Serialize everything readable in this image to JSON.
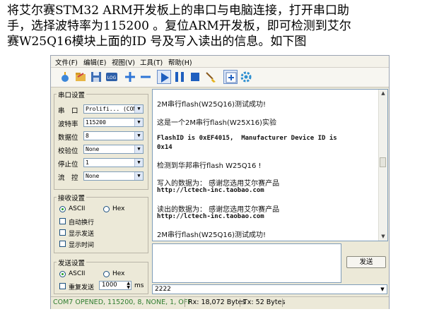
{
  "caption": {
    "line1": " 将艾尔赛STM32 ARM开发板上的串口与电脑连接，打开串口助",
    "line2": "手，选择波特率为115200 。复位ARM开发板，即可检测到艾尔",
    "line3": "赛W25Q16模块上面的ID 号及写入读出的信息。如下图"
  },
  "menu": [
    "文件(F)",
    "编辑(E)",
    "视图(V)",
    "工具(T)",
    "帮助(H)"
  ],
  "toolbar_icons": [
    "new-icon",
    "open-icon",
    "save-icon",
    "log-icon",
    "plus-icon",
    "minus-icon",
    "play-icon",
    "pause-icon",
    "stop-icon",
    "clear-brush-icon",
    "add-window-icon",
    "settings-icon"
  ],
  "serial_settings": {
    "title": "串口设置",
    "port_label": "串　口",
    "port_value": "Prolifi... (COM7",
    "baud_label": "波特率",
    "baud_value": "115200",
    "databits_label": "数据位",
    "databits_value": "8",
    "parity_label": "校验位",
    "parity_value": "None",
    "stopbits_label": "停止位",
    "stopbits_value": "1",
    "flow_label": "流　控",
    "flow_value": "None"
  },
  "receive_settings": {
    "title": "接收设置",
    "ascii": "ASCII",
    "hex": "Hex",
    "selected": "ASCII",
    "auto_wrap": "自动换行",
    "show_send": "显示发送",
    "show_time": "显示时间"
  },
  "send_settings": {
    "title": "发送设置",
    "ascii": "ASCII",
    "hex": "Hex",
    "selected": "ASCII",
    "repeat_label": "重复发送",
    "repeat_interval": "1000",
    "unit": "ms"
  },
  "receive_lines": [
    "2M串行flash(W25Q16)测试成功!",
    "这是一个2M串行flash(W25X16)实验",
    "FlashID is 0xEF4015,  Manufacturer Device ID is",
    "0x14",
    "检测到华邦串行flash W25Q16 !",
    "写入的数据为： 感谢您选用艾尔赛产品",
    "http://lctech-inc.taobao.com",
    "读出的数据为： 感谢您选用艾尔赛产品",
    "http://lctech-inc.taobao.com",
    "2M串行flash(W25Q16)测试成功!"
  ],
  "send": {
    "button": "发送",
    "history_value": "2222"
  },
  "status": {
    "port_state": "COM7 OPENED, 115200, 8, NONE, 1, OFF",
    "rx": "Rx: 18,072 Bytes",
    "tx": "Tx: 52 Bytes"
  },
  "colors": {
    "status_text": "#2f7d2f",
    "accent_blue": "#1f5fbf"
  }
}
